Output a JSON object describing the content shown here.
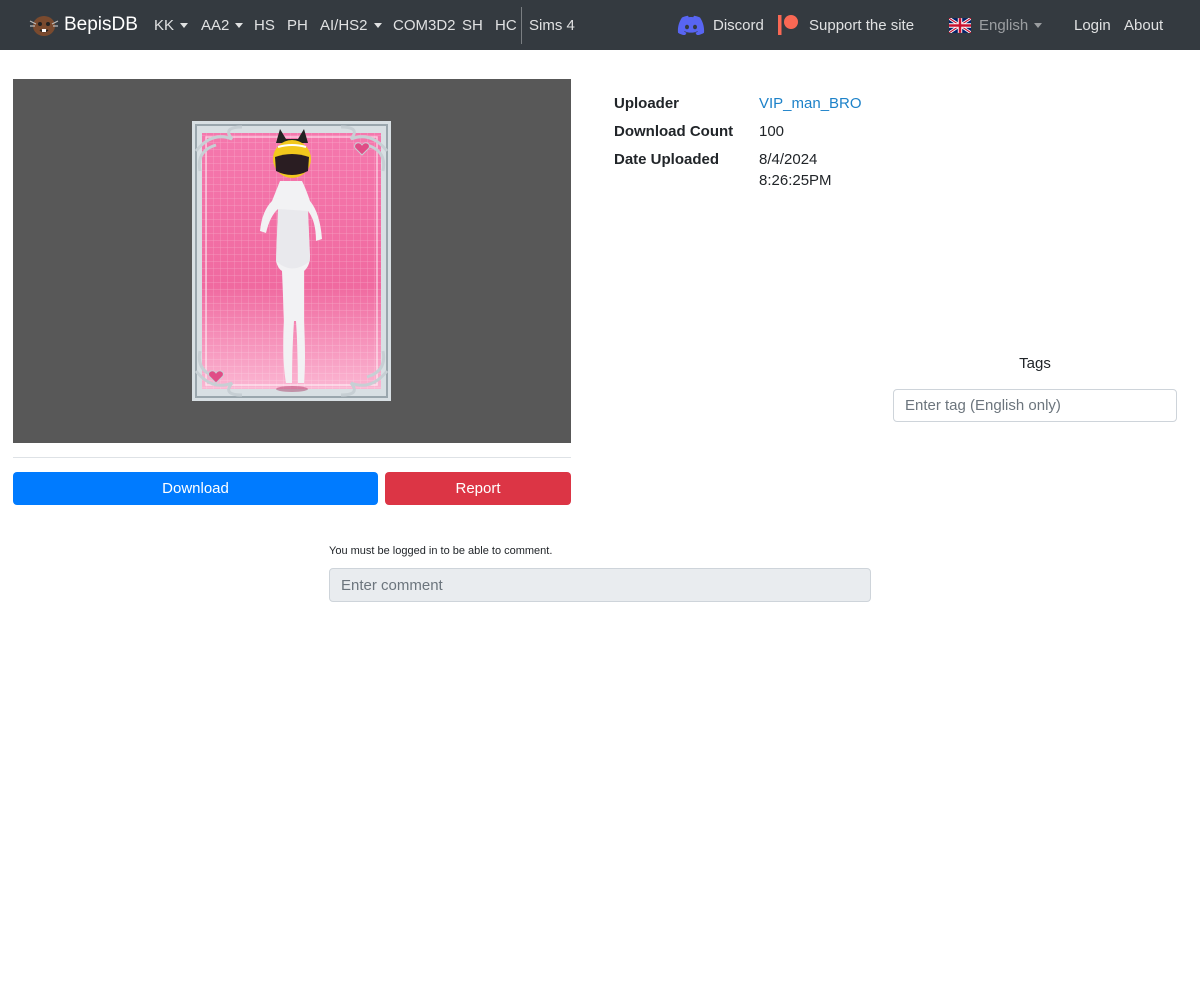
{
  "navbar": {
    "brand": "BepisDB",
    "items": [
      {
        "label": "KK",
        "dropdown": true
      },
      {
        "label": "AA2",
        "dropdown": true
      },
      {
        "label": "HS",
        "dropdown": false
      },
      {
        "label": "PH",
        "dropdown": false
      },
      {
        "label": "AI/HS2",
        "dropdown": true
      },
      {
        "label": "COM3D2",
        "dropdown": false
      },
      {
        "label": "SH",
        "dropdown": false
      },
      {
        "label": "HC",
        "dropdown": false
      },
      {
        "label": "Sims 4",
        "dropdown": false
      }
    ],
    "discord": "Discord",
    "support": "Support the site",
    "language": "English",
    "login": "Login",
    "about": "About"
  },
  "card": {
    "info": {
      "uploader_label": "Uploader",
      "uploader_value": "VIP_man_BRO",
      "download_count_label": "Download Count",
      "download_count_value": "100",
      "date_uploaded_label": "Date Uploaded",
      "date_value": "8/4/2024",
      "time_value": "8:26:25PM"
    },
    "download_label": "Download",
    "report_label": "Report"
  },
  "tags": {
    "title": "Tags",
    "placeholder": "Enter tag (English only)"
  },
  "comments": {
    "login_note": "You must be logged in to be able to comment.",
    "placeholder": "Enter comment"
  },
  "colors": {
    "navbar": "#343a40",
    "download": "#007bff",
    "report": "#dc3545",
    "link": "#1d82c9",
    "preview_bg": "#585858",
    "card_pink": "#f06aa0"
  }
}
